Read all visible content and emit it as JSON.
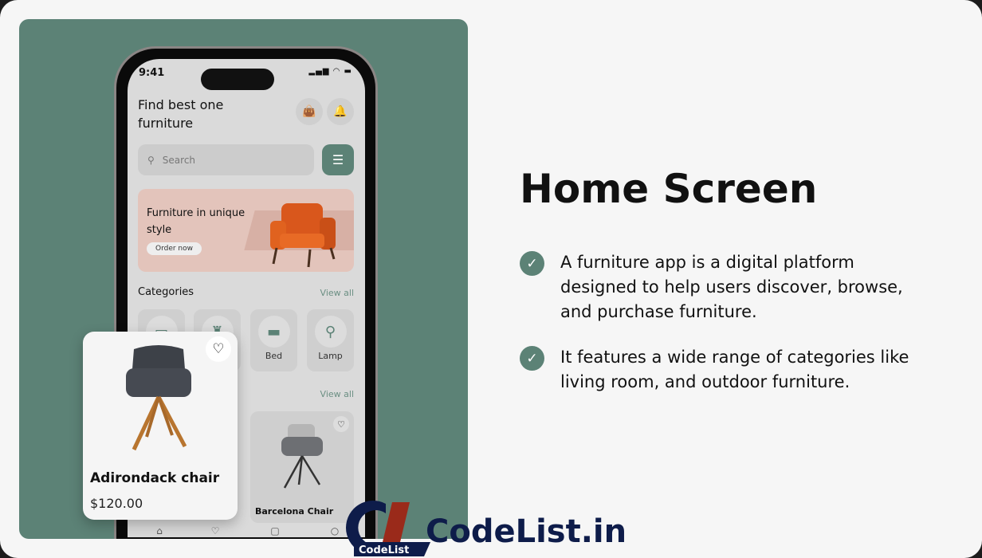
{
  "phone": {
    "status_time": "9:41",
    "heading": "Find best one furniture",
    "search_placeholder": "Search",
    "banner": {
      "title": "Furniture in unique style",
      "button": "Order now"
    },
    "categories_title": "Categories",
    "view_all": "View all",
    "categories": [
      {
        "label": "",
        "icon": "tv-stand-icon"
      },
      {
        "label": "",
        "icon": "chair-icon"
      },
      {
        "label": "Bed",
        "icon": "bed-icon"
      },
      {
        "label": "Lamp",
        "icon": "lamp-icon"
      }
    ],
    "product": {
      "name": "Barcelona Chair"
    },
    "featured": {
      "name": "Adirondack chair",
      "price": "$120.00"
    }
  },
  "content": {
    "title": "Home Screen",
    "bullets": [
      "A furniture app is a digital platform designed to help users discover, browse, and purchase furniture.",
      "It features a wide range of categories like living room, and outdoor furniture."
    ]
  },
  "logo": {
    "text": "CodeList.in",
    "badge": "CodeList"
  },
  "colors": {
    "accent": "#5c8276",
    "logo_navy": "#0e1c4a",
    "logo_red": "#9a2a1a"
  }
}
